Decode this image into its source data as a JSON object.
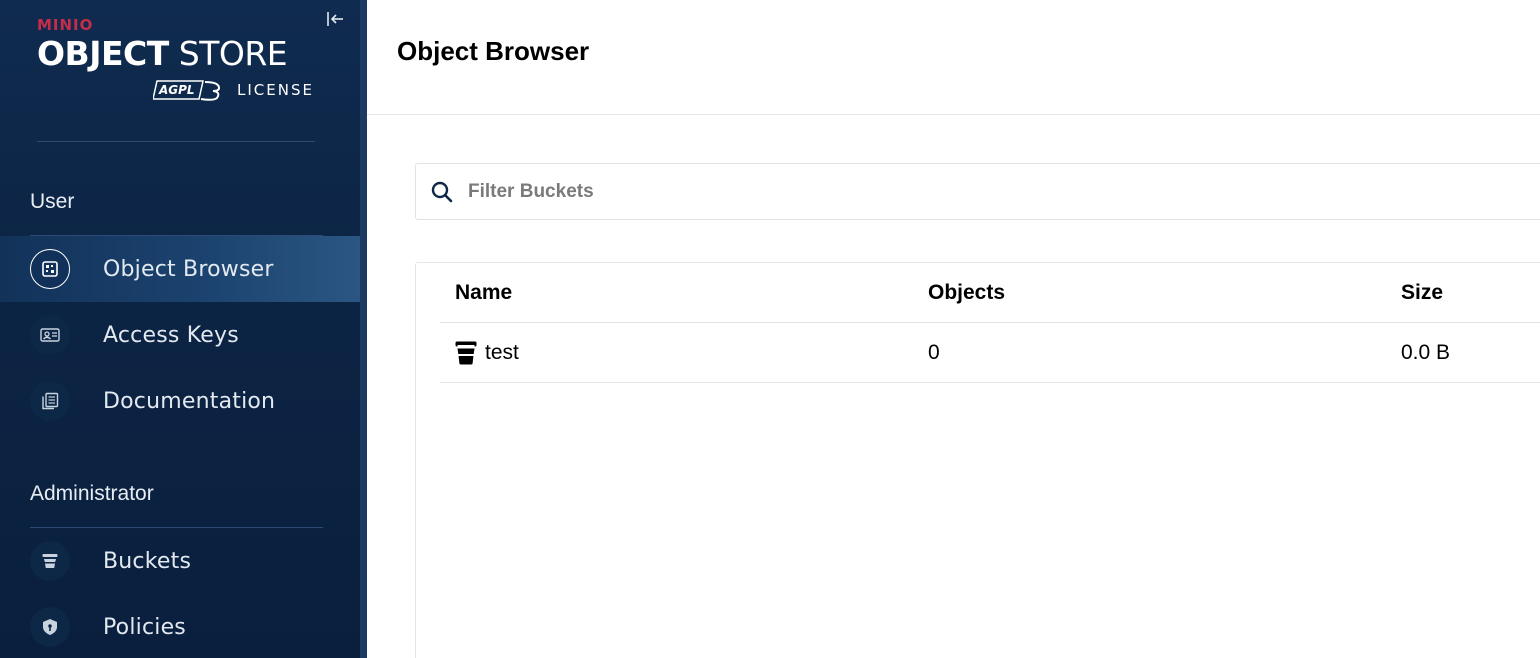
{
  "brand": {
    "company": "MINIO",
    "product_bold": "OBJECT",
    "product_light": " STORE",
    "badge": "AGPLv3",
    "license": "LICENSE"
  },
  "sidebar": {
    "sections": [
      {
        "label": "User",
        "items": [
          {
            "label": "Object Browser",
            "icon": "object-browser-icon",
            "active": true
          },
          {
            "label": "Access Keys",
            "icon": "access-keys-icon",
            "active": false
          },
          {
            "label": "Documentation",
            "icon": "documentation-icon",
            "active": false
          }
        ]
      },
      {
        "label": "Administrator",
        "items": [
          {
            "label": "Buckets",
            "icon": "bucket-icon",
            "active": false
          },
          {
            "label": "Policies",
            "icon": "shield-icon",
            "active": false
          }
        ]
      }
    ]
  },
  "header": {
    "title": "Object Browser"
  },
  "search": {
    "placeholder": "Filter Buckets",
    "value": ""
  },
  "table": {
    "columns": [
      "Name",
      "Objects",
      "Size"
    ],
    "rows": [
      {
        "name": "test",
        "objects": "0",
        "size": "0.0 B"
      }
    ]
  },
  "colors": {
    "sidebar_bg": "#0c2444",
    "brand_red": "#c72c48",
    "active_item": "#1b426e"
  }
}
